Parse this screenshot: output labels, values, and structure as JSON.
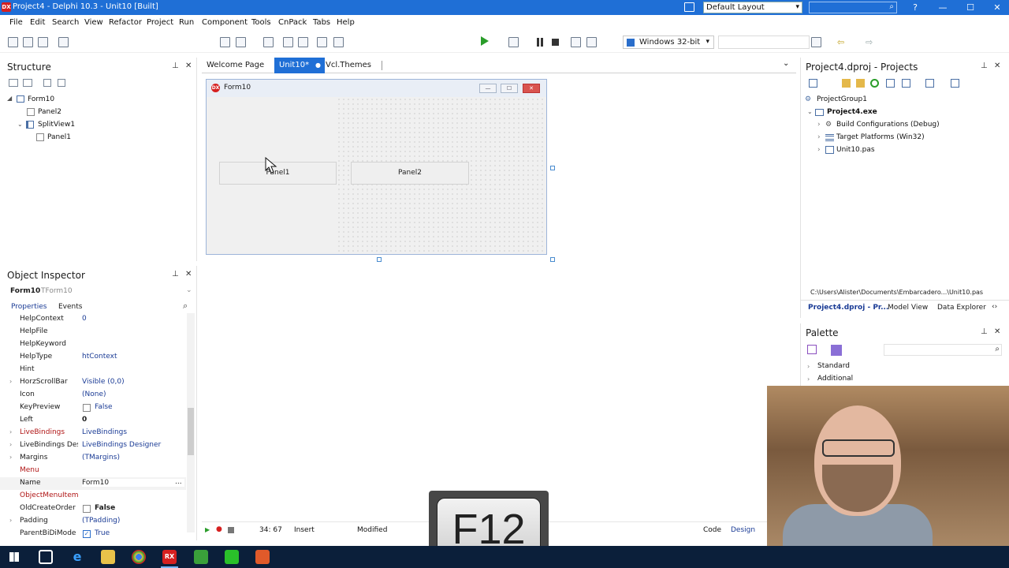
{
  "window": {
    "app_icon_text": "DX",
    "title": "Project4 - Delphi 10.3 - Unit10 [Built]",
    "layout_select": "Default Layout",
    "controls": [
      "—",
      "☐",
      "✕"
    ],
    "help": "?"
  },
  "menu": [
    "File",
    "Edit",
    "Search",
    "View",
    "Refactor",
    "Project",
    "Run",
    "Component",
    "Tools",
    "CnPack",
    "Tabs",
    "Help"
  ],
  "toolbar": {
    "platform": "Windows 32-bit"
  },
  "structure": {
    "title": "Structure",
    "items": [
      {
        "label": "Form10"
      },
      {
        "label": "Panel2"
      },
      {
        "label": "SplitView1"
      },
      {
        "label": "Panel1"
      }
    ]
  },
  "inspector": {
    "title": "Object Inspector",
    "object_name": "Form10",
    "object_type": "TForm10",
    "tabs": [
      "Properties",
      "Events"
    ],
    "rows": [
      {
        "name": "HelpContext",
        "value": "0"
      },
      {
        "name": "HelpFile",
        "value": ""
      },
      {
        "name": "HelpKeyword",
        "value": ""
      },
      {
        "name": "HelpType",
        "value": "htContext"
      },
      {
        "name": "Hint",
        "value": ""
      },
      {
        "name": "HorzScrollBar",
        "value": "Visible (0,0)"
      },
      {
        "name": "Icon",
        "value": "(None)"
      },
      {
        "name": "KeyPreview",
        "value": "False"
      },
      {
        "name": "Left",
        "value": "0"
      },
      {
        "name": "LiveBindings",
        "value": "LiveBindings"
      },
      {
        "name": "LiveBindings Designer",
        "value": "LiveBindings Designer"
      },
      {
        "name": "Margins",
        "value": "(TMargins)"
      },
      {
        "name": "Menu",
        "value": ""
      },
      {
        "name": "Name",
        "value": "Form10"
      },
      {
        "name": "ObjectMenuItem",
        "value": ""
      },
      {
        "name": "OldCreateOrder",
        "value": "False"
      },
      {
        "name": "Padding",
        "value": "(TPadding)"
      },
      {
        "name": "ParentBiDiMode",
        "value": "True"
      }
    ],
    "ellipsis": "..."
  },
  "editor": {
    "tabs": [
      {
        "label": "Welcome Page"
      },
      {
        "label": "Unit10*"
      },
      {
        "label": "Vcl.Themes"
      }
    ]
  },
  "designer": {
    "form_icon_text": "DX",
    "form_title": "Form10",
    "panel1": "Panel1",
    "panel2": "Panel2"
  },
  "status": {
    "position": "34: 67",
    "mode": "Insert",
    "state": "Modified",
    "view_code": "Code",
    "view_design": "Design"
  },
  "projects": {
    "title": "Project4.dproj - Projects",
    "tree": [
      {
        "label": "ProjectGroup1"
      },
      {
        "label": "Project4.exe"
      },
      {
        "label": "Build Configurations (Debug)"
      },
      {
        "label": "Target Platforms (Win32)"
      },
      {
        "label": "Unit10.pas"
      }
    ],
    "path": "C:\\Users\\Alister\\Documents\\Embarcadero...\\Unit10.pas",
    "tabs": [
      "Project4.dproj - Pr...",
      "Model View",
      "Data Explorer"
    ]
  },
  "palette": {
    "title": "Palette",
    "categories": [
      "Standard",
      "Additional"
    ]
  },
  "keycap": "F12",
  "colors": {
    "accent": "#1f6fd6",
    "property_red": "#b01515",
    "property_navy": "#1a3b95"
  }
}
